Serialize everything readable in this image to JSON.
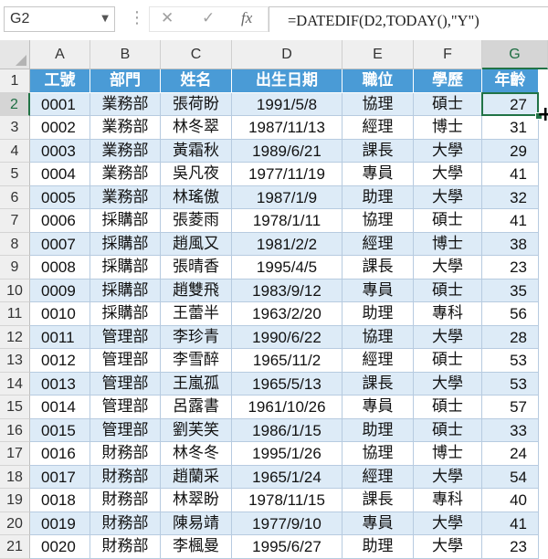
{
  "formula_bar": {
    "name_box": "G2",
    "cancel_glyph": "✕",
    "enter_glyph": "✓",
    "fx_label": "fx",
    "formula": "=DATEDIF(D2,TODAY(),\"Y\")"
  },
  "columns": [
    "A",
    "B",
    "C",
    "D",
    "E",
    "F",
    "G"
  ],
  "rows": [
    "1",
    "2",
    "3",
    "4",
    "5",
    "6",
    "7",
    "8",
    "9",
    "10",
    "11",
    "12",
    "13",
    "14",
    "15",
    "16",
    "17",
    "18",
    "19",
    "20",
    "21"
  ],
  "active_cell": "G2",
  "colors": {
    "header_bg": "#4a9bd6",
    "band_light": "#ddebf7",
    "band_white": "#ffffff",
    "selection": "#217346"
  },
  "table": {
    "headers": [
      "工號",
      "部門",
      "姓名",
      "出生日期",
      "職位",
      "學歷",
      "年齡"
    ],
    "rows": [
      [
        "0001",
        "業務部",
        "張荷盼",
        "1991/5/8",
        "協理",
        "碩士",
        "27"
      ],
      [
        "0002",
        "業務部",
        "林冬翠",
        "1987/11/13",
        "經理",
        "博士",
        "31"
      ],
      [
        "0003",
        "業務部",
        "黃霜秋",
        "1989/6/21",
        "課長",
        "大學",
        "29"
      ],
      [
        "0004",
        "業務部",
        "吳凡夜",
        "1977/11/19",
        "專員",
        "大學",
        "41"
      ],
      [
        "0005",
        "業務部",
        "林瑤傲",
        "1987/1/9",
        "助理",
        "大學",
        "32"
      ],
      [
        "0006",
        "採購部",
        "張菱雨",
        "1978/1/11",
        "協理",
        "碩士",
        "41"
      ],
      [
        "0007",
        "採購部",
        "趙風又",
        "1981/2/2",
        "經理",
        "博士",
        "38"
      ],
      [
        "0008",
        "採購部",
        "張晴香",
        "1995/4/5",
        "課長",
        "大學",
        "23"
      ],
      [
        "0009",
        "採購部",
        "趙雙飛",
        "1983/9/12",
        "專員",
        "碩士",
        "35"
      ],
      [
        "0010",
        "採購部",
        "王蕾半",
        "1963/2/20",
        "助理",
        "專科",
        "56"
      ],
      [
        "0011",
        "管理部",
        "李珍青",
        "1990/6/22",
        "協理",
        "大學",
        "28"
      ],
      [
        "0012",
        "管理部",
        "李雪醉",
        "1965/11/2",
        "經理",
        "碩士",
        "53"
      ],
      [
        "0013",
        "管理部",
        "王嵐孤",
        "1965/5/13",
        "課長",
        "大學",
        "53"
      ],
      [
        "0014",
        "管理部",
        "呂露書",
        "1961/10/26",
        "專員",
        "碩士",
        "57"
      ],
      [
        "0015",
        "管理部",
        "劉芙笑",
        "1986/1/15",
        "助理",
        "碩士",
        "33"
      ],
      [
        "0016",
        "財務部",
        "林冬冬",
        "1995/1/26",
        "協理",
        "博士",
        "24"
      ],
      [
        "0017",
        "財務部",
        "趙蘭采",
        "1965/1/24",
        "經理",
        "大學",
        "54"
      ],
      [
        "0018",
        "財務部",
        "林翠盼",
        "1978/11/15",
        "課長",
        "專科",
        "40"
      ],
      [
        "0019",
        "財務部",
        "陳易靖",
        "1977/9/10",
        "專員",
        "大學",
        "41"
      ],
      [
        "0020",
        "財務部",
        "李楓曼",
        "1995/6/27",
        "助理",
        "大學",
        "23"
      ]
    ]
  }
}
